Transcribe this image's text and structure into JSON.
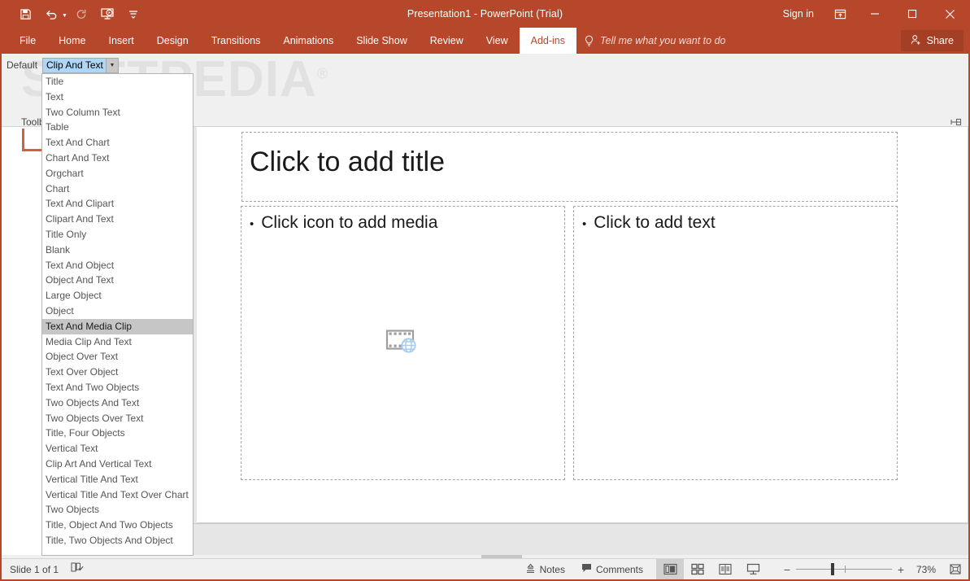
{
  "titlebar": {
    "title": "Presentation1 - PowerPoint (Trial)",
    "signin": "Sign in",
    "quick_access": [
      {
        "name": "save-icon",
        "tip": "Save"
      },
      {
        "name": "undo-icon",
        "tip": "Undo"
      },
      {
        "name": "redo-icon",
        "tip": "Redo"
      },
      {
        "name": "start-slideshow-icon",
        "tip": "Start From Beginning"
      },
      {
        "name": "customize-qat-icon",
        "tip": "Customize Quick Access Toolbar"
      }
    ],
    "window_controls": [
      {
        "name": "ribbon-display-options-icon",
        "glyph": "ribbon"
      },
      {
        "name": "minimize-button",
        "glyph": "minimize"
      },
      {
        "name": "maximize-button",
        "glyph": "maximize"
      },
      {
        "name": "close-button",
        "glyph": "close"
      }
    ]
  },
  "ribbon": {
    "tabs": [
      {
        "label": "File",
        "active": false
      },
      {
        "label": "Home",
        "active": false
      },
      {
        "label": "Insert",
        "active": false
      },
      {
        "label": "Design",
        "active": false
      },
      {
        "label": "Transitions",
        "active": false
      },
      {
        "label": "Animations",
        "active": false
      },
      {
        "label": "Slide Show",
        "active": false
      },
      {
        "label": "Review",
        "active": false
      },
      {
        "label": "View",
        "active": false
      },
      {
        "label": "Add-ins",
        "active": true
      }
    ],
    "tell_me": "Tell me what you want to do",
    "share": "Share",
    "collapse_tip": "Collapse the Ribbon"
  },
  "addin_bar": {
    "default_label": "Default",
    "combo_value": "Clip And Text",
    "toolbar_label": "Toolb",
    "watermark": "SOFTPEDIA"
  },
  "dropdown": {
    "selected": "Text And Media Clip",
    "items": [
      "Title",
      "Text",
      "Two Column Text",
      "Table",
      "Text And Chart",
      "Chart And Text",
      "Orgchart",
      "Chart",
      "Text And Clipart",
      "Clipart And Text",
      "Title Only",
      "Blank",
      "Text And Object",
      "Object And Text",
      "Large Object",
      "Object",
      "Text And Media Clip",
      "Media Clip And Text",
      "Object Over Text",
      "Text Over Object",
      "Text And Two Objects",
      "Two Objects And Text",
      "Two Objects Over Text",
      "Title, Four Objects",
      "Vertical Text",
      "Clip Art And Vertical Text",
      "Vertical Title And Text",
      "Vertical Title And Text Over Chart",
      "Two Objects",
      "Title, Object And Two Objects",
      "Title, Two Objects And Object"
    ]
  },
  "slide": {
    "title_placeholder": "Click to add title",
    "media_placeholder": "Click icon to add media",
    "text_placeholder": "Click to add text",
    "bullet": "•",
    "media_icon_name": "insert-video-icon"
  },
  "statusbar": {
    "slide_counter": "Slide 1 of 1",
    "accessibility_icon": "accessibility-checker-icon",
    "notes": "Notes",
    "comments": "Comments",
    "views": [
      {
        "name": "normal-view-button",
        "label": "Normal",
        "active": true
      },
      {
        "name": "slide-sorter-view-button",
        "label": "Slide Sorter",
        "active": false
      },
      {
        "name": "reading-view-button",
        "label": "Reading View",
        "active": false
      },
      {
        "name": "slideshow-view-button",
        "label": "Slide Show",
        "active": false
      }
    ],
    "zoom_out": "−",
    "zoom_in": "+",
    "zoom_level": "73%",
    "fit_button": "fit-slide-to-window-icon"
  },
  "colors": {
    "ribbon": "#B7472A",
    "share_button": "#a33f25",
    "combo_highlight": "#aed6f7",
    "dropdown_selected": "#c6c6c6",
    "workarea": "#e6e6e6",
    "media_icon_globe": "#a8cdeb"
  }
}
